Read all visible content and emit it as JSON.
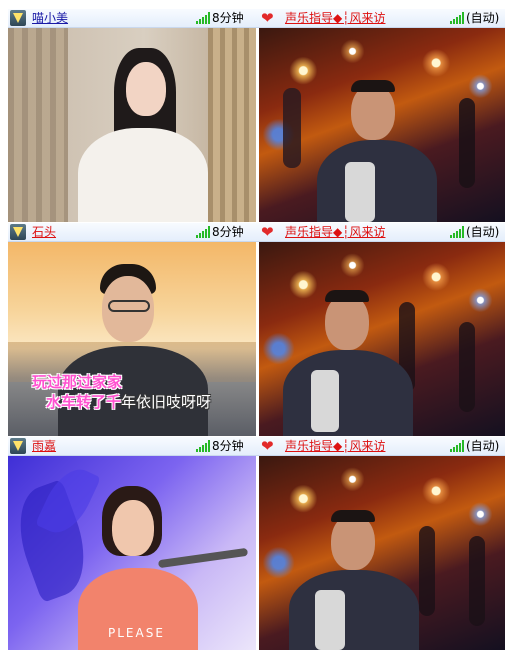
{
  "rows": [
    {
      "left": {
        "name": "喵小美",
        "time": "8分钟"
      },
      "right": {
        "name": "声乐指导◆┆风来访",
        "status": "(自动)"
      }
    },
    {
      "left": {
        "name": "石头",
        "time": "8分钟",
        "lyrics": {
          "line1": "玩过那过家家",
          "line2_highlight": "水车转了千",
          "line2_rest": "年依旧吱呀呀"
        }
      },
      "right": {
        "name": "声乐指导◆┆风来访",
        "status": "(自动)"
      }
    },
    {
      "left": {
        "name": "雨嘉",
        "time": "8分钟",
        "shirt_text": "PLEASE"
      },
      "right": {
        "name": "声乐指导◆┆风来访",
        "status": "(自动)"
      }
    }
  ],
  "icons": {
    "user_badge": "vip-badge-icon",
    "heart": "heart-icon",
    "signal": "signal-strength-icon"
  },
  "colors": {
    "name_link": "#1a1aa6",
    "host_name": "#d11111",
    "signal": "#27b927",
    "lyrics": "#ff52d0",
    "heart": "#e22a2a"
  }
}
